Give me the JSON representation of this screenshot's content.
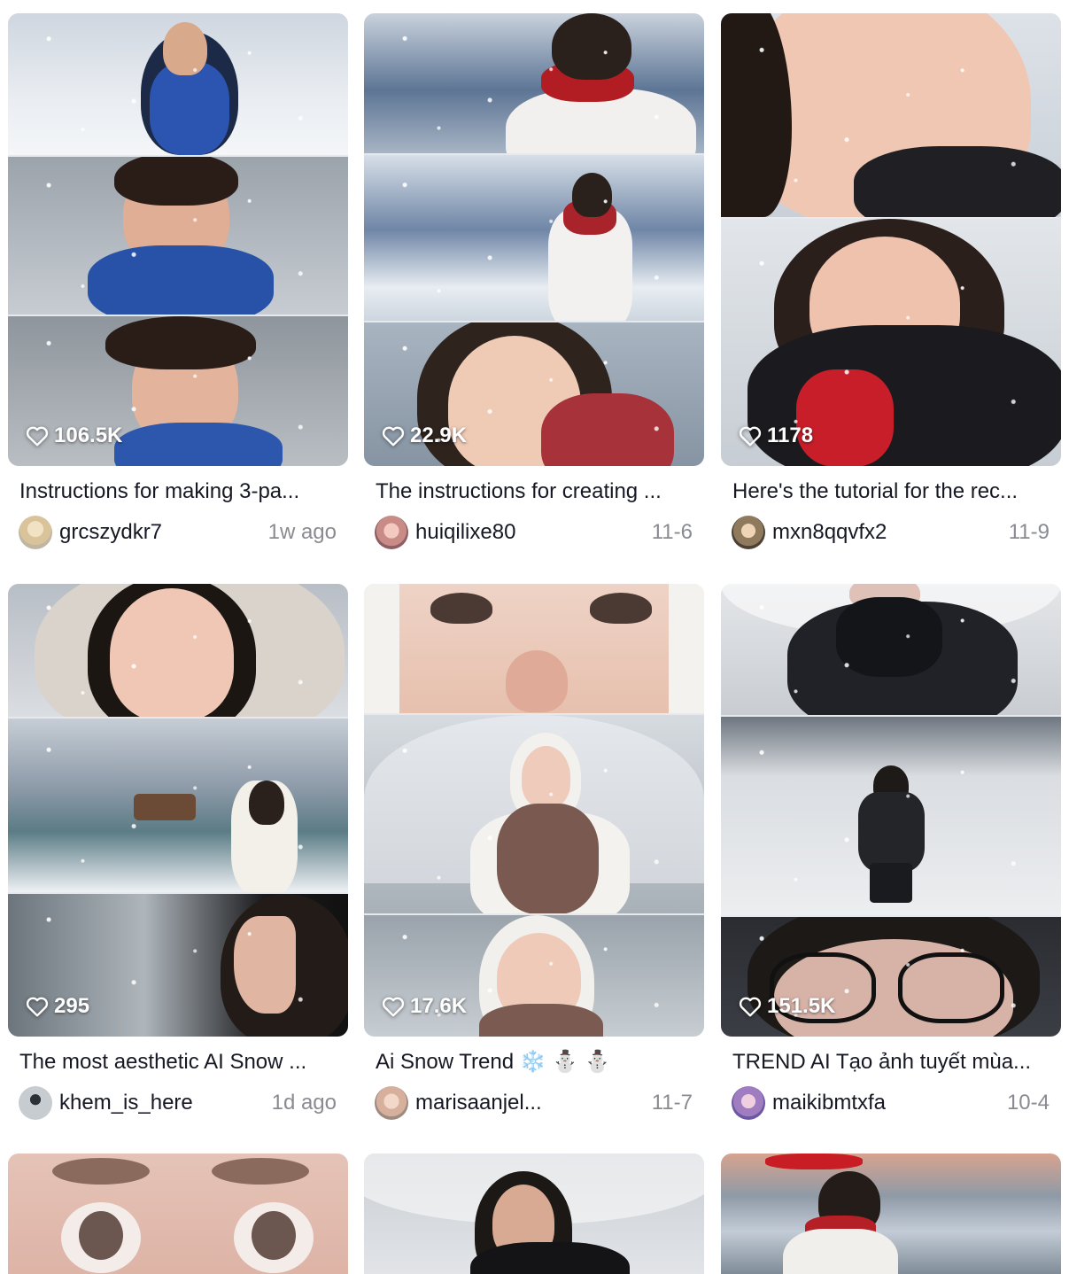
{
  "colors": {
    "text": "#161823",
    "muted": "#8a8b91",
    "background": "#ffffff"
  },
  "videos": [
    {
      "likes": "106.5K",
      "title": "Instructions for making 3-pa...",
      "author": "grcszydkr7",
      "date": "1w ago"
    },
    {
      "likes": "22.9K",
      "title": "The instructions for creating ...",
      "author": "huiqilixe80",
      "date": "11-6"
    },
    {
      "likes": "1178",
      "title": "Here's the tutorial for the rec...",
      "author": "mxn8qqvfx2",
      "date": "11-9"
    },
    {
      "likes": "295",
      "title": "The most aesthetic AI Snow ...",
      "author": "khem_is_here",
      "date": "1d ago"
    },
    {
      "likes": "17.6K",
      "title": "Ai Snow Trend ❄️ ⛄ ⛄",
      "author": "marisaanjel...",
      "date": "11-7"
    },
    {
      "likes": "151.5K",
      "title": "TREND AI Tạo ảnh tuyết mùa...",
      "author": "maikibmtxfa",
      "date": "10-4"
    }
  ]
}
